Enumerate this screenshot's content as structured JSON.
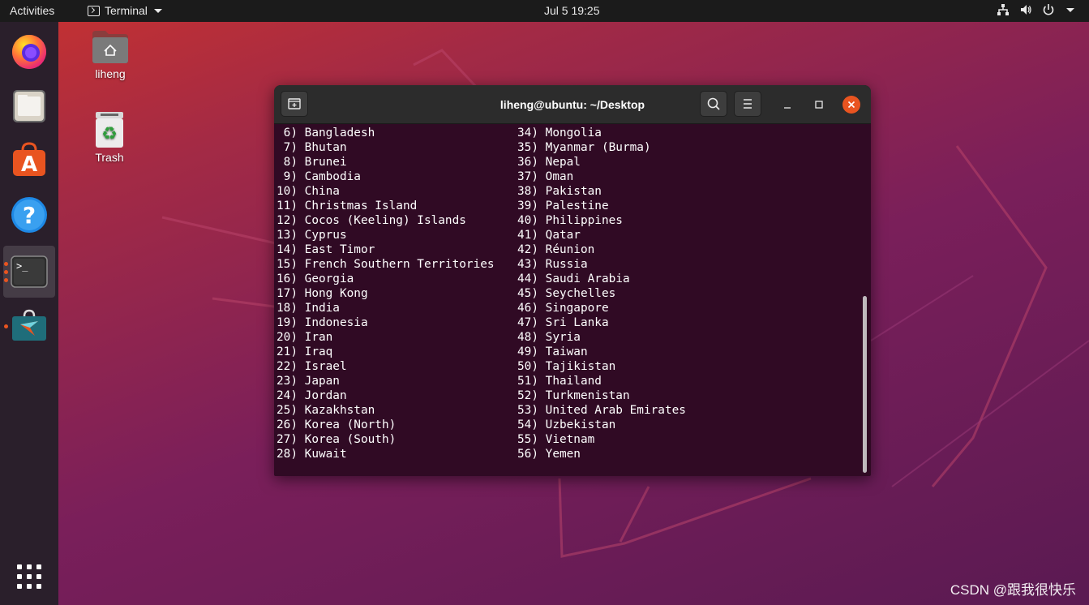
{
  "topbar": {
    "activities": "Activities",
    "app_name": "Terminal",
    "clock": "Jul 5  19:25",
    "tray_icons": [
      "network-icon",
      "volume-icon",
      "power-icon",
      "caret-down-icon"
    ]
  },
  "dock": {
    "items": [
      "firefox-icon",
      "files-icon",
      "software-icon",
      "help-icon",
      "terminal-icon",
      "installer-icon"
    ],
    "show_apps": "grid-icon"
  },
  "desktop": {
    "home_label": "liheng",
    "trash_label": "Trash"
  },
  "terminal": {
    "title": "liheng@ubuntu: ~/Desktop",
    "left_column": [
      " 6) Bangladesh",
      " 7) Bhutan",
      " 8) Brunei",
      " 9) Cambodia",
      "10) China",
      "11) Christmas Island",
      "12) Cocos (Keeling) Islands",
      "13) Cyprus",
      "14) East Timor",
      "15) French Southern Territories",
      "16) Georgia",
      "17) Hong Kong",
      "18) India",
      "19) Indonesia",
      "20) Iran",
      "21) Iraq",
      "22) Israel",
      "23) Japan",
      "24) Jordan",
      "25) Kazakhstan",
      "26) Korea (North)",
      "27) Korea (South)",
      "28) Kuwait"
    ],
    "right_column": [
      "34) Mongolia",
      "35) Myanmar (Burma)",
      "36) Nepal",
      "37) Oman",
      "38) Pakistan",
      "39) Palestine",
      "40) Philippines",
      "41) Qatar",
      "42) Réunion",
      "43) Russia",
      "44) Saudi Arabia",
      "45) Seychelles",
      "46) Singapore",
      "47) Sri Lanka",
      "48) Syria",
      "49) Taiwan",
      "50) Tajikistan",
      "51) Thailand",
      "52) Turkmenistan",
      "53) United Arab Emirates",
      "54) Uzbekistan",
      "55) Vietnam",
      "56) Yemen"
    ],
    "prompt": "#?"
  },
  "watermark": "CSDN @跟我很快乐",
  "colors": {
    "terminal_bg": "#300a24",
    "accent": "#e95420",
    "topbar_bg": "#1b1b1b"
  }
}
